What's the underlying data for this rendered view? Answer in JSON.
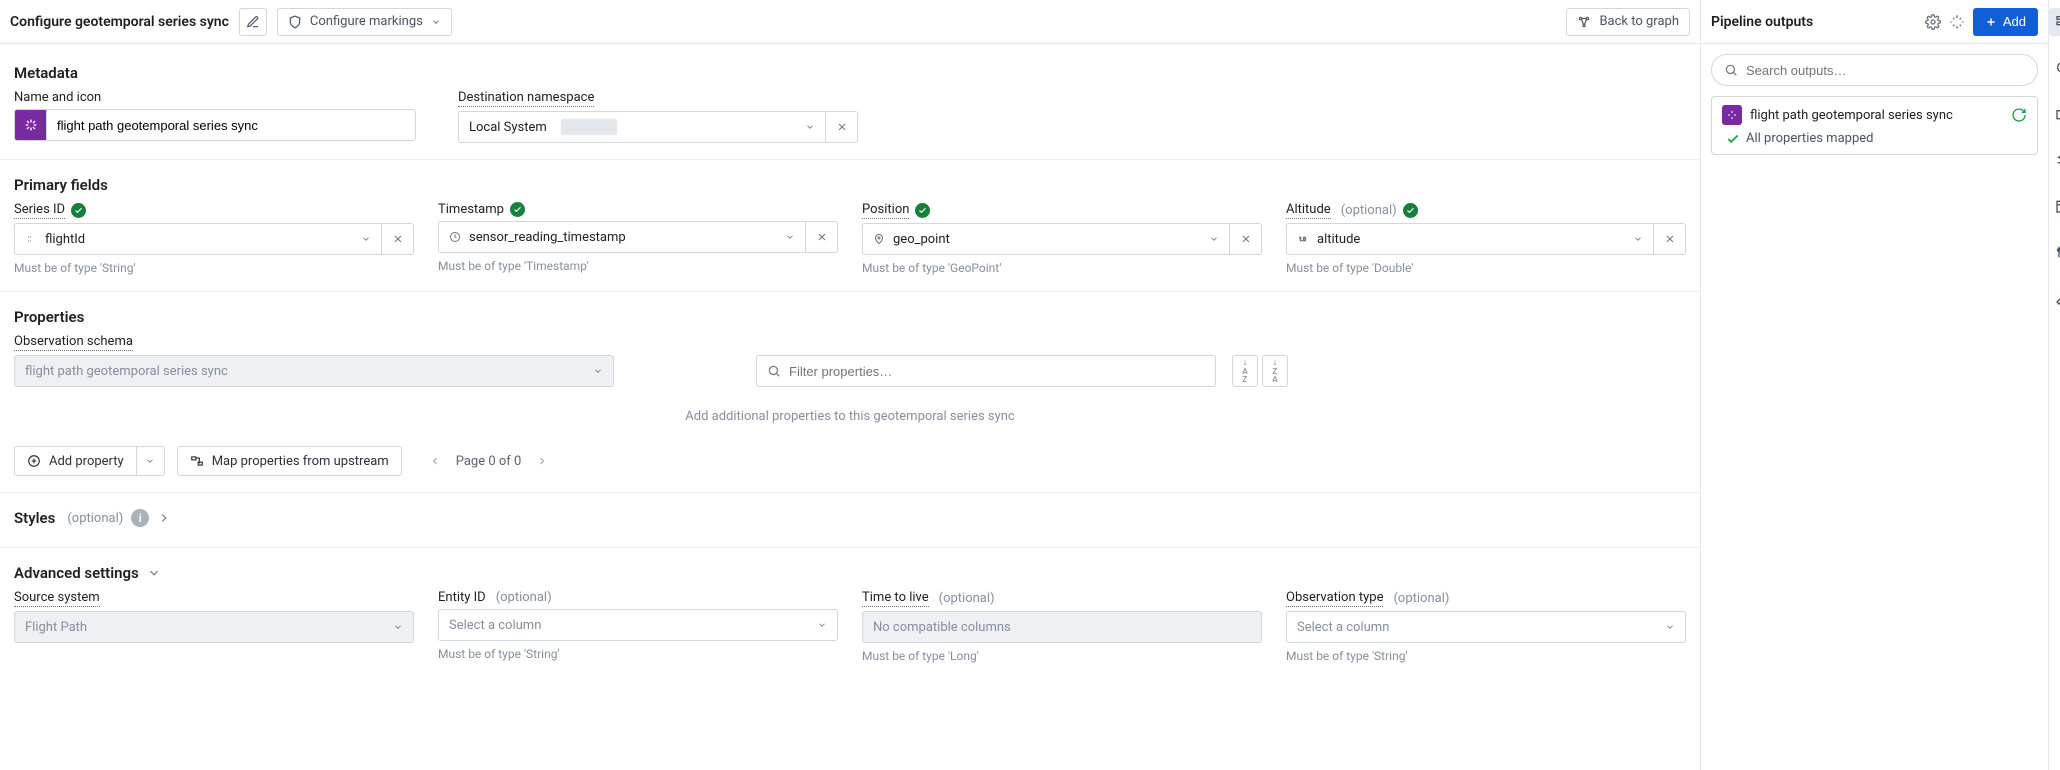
{
  "toolbar": {
    "title": "Configure geotemporal series sync",
    "markings": "Configure markings",
    "back": "Back to graph"
  },
  "metadata": {
    "heading": "Metadata",
    "name_label": "Name and icon",
    "name_value": "flight path geotemporal series sync",
    "dest_label": "Destination namespace",
    "dest_value": "Local System"
  },
  "primary": {
    "heading": "Primary fields",
    "series": {
      "label": "Series ID",
      "value": "flightId",
      "hint": "Must be of type 'String'"
    },
    "timestamp": {
      "label": "Timestamp",
      "value": "sensor_reading_timestamp",
      "hint": "Must be of type 'Timestamp'"
    },
    "position": {
      "label": "Position",
      "value": "geo_point",
      "hint": "Must be of type 'GeoPoint'"
    },
    "altitude": {
      "label": "Altitude",
      "optional": "(optional)",
      "value": "altitude",
      "hint": "Must be of type 'Double'"
    }
  },
  "properties": {
    "heading": "Properties",
    "schema_label": "Observation schema",
    "schema_value": "flight path geotemporal series sync",
    "filter_placeholder": "Filter properties…",
    "hint": "Add additional properties to this geotemporal series sync",
    "add_property": "Add property",
    "map_upstream": "Map properties from upstream",
    "pager": "Page 0 of 0"
  },
  "styles": {
    "heading": "Styles",
    "optional": "(optional)"
  },
  "advanced": {
    "heading": "Advanced settings",
    "source": {
      "label": "Source system",
      "value": "Flight Path"
    },
    "entity": {
      "label": "Entity ID",
      "optional": "(optional)",
      "placeholder": "Select a column",
      "hint": "Must be of type 'String'"
    },
    "ttl": {
      "label": "Time to live",
      "optional": "(optional)",
      "placeholder": "No compatible columns",
      "hint": "Must be of type 'Long'"
    },
    "obstype": {
      "label": "Observation type",
      "optional": "(optional)",
      "placeholder": "Select a column",
      "hint": "Must be of type 'String'"
    }
  },
  "pipeline": {
    "title": "Pipeline outputs",
    "add": "Add",
    "search_placeholder": "Search outputs…",
    "card_title": "flight path geotemporal series sync",
    "card_status": "All properties mapped"
  }
}
